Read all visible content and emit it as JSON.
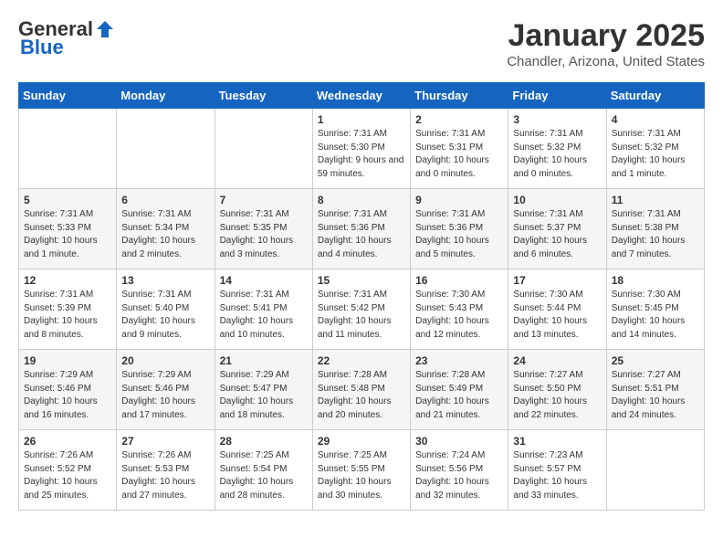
{
  "logo": {
    "general": "General",
    "blue": "Blue"
  },
  "header": {
    "title": "January 2025",
    "subtitle": "Chandler, Arizona, United States"
  },
  "days_of_week": [
    "Sunday",
    "Monday",
    "Tuesday",
    "Wednesday",
    "Thursday",
    "Friday",
    "Saturday"
  ],
  "weeks": [
    [
      {
        "num": "",
        "info": ""
      },
      {
        "num": "",
        "info": ""
      },
      {
        "num": "",
        "info": ""
      },
      {
        "num": "1",
        "info": "Sunrise: 7:31 AM\nSunset: 5:30 PM\nDaylight: 9 hours and 59 minutes."
      },
      {
        "num": "2",
        "info": "Sunrise: 7:31 AM\nSunset: 5:31 PM\nDaylight: 10 hours and 0 minutes."
      },
      {
        "num": "3",
        "info": "Sunrise: 7:31 AM\nSunset: 5:32 PM\nDaylight: 10 hours and 0 minutes."
      },
      {
        "num": "4",
        "info": "Sunrise: 7:31 AM\nSunset: 5:32 PM\nDaylight: 10 hours and 1 minute."
      }
    ],
    [
      {
        "num": "5",
        "info": "Sunrise: 7:31 AM\nSunset: 5:33 PM\nDaylight: 10 hours and 1 minute."
      },
      {
        "num": "6",
        "info": "Sunrise: 7:31 AM\nSunset: 5:34 PM\nDaylight: 10 hours and 2 minutes."
      },
      {
        "num": "7",
        "info": "Sunrise: 7:31 AM\nSunset: 5:35 PM\nDaylight: 10 hours and 3 minutes."
      },
      {
        "num": "8",
        "info": "Sunrise: 7:31 AM\nSunset: 5:36 PM\nDaylight: 10 hours and 4 minutes."
      },
      {
        "num": "9",
        "info": "Sunrise: 7:31 AM\nSunset: 5:36 PM\nDaylight: 10 hours and 5 minutes."
      },
      {
        "num": "10",
        "info": "Sunrise: 7:31 AM\nSunset: 5:37 PM\nDaylight: 10 hours and 6 minutes."
      },
      {
        "num": "11",
        "info": "Sunrise: 7:31 AM\nSunset: 5:38 PM\nDaylight: 10 hours and 7 minutes."
      }
    ],
    [
      {
        "num": "12",
        "info": "Sunrise: 7:31 AM\nSunset: 5:39 PM\nDaylight: 10 hours and 8 minutes."
      },
      {
        "num": "13",
        "info": "Sunrise: 7:31 AM\nSunset: 5:40 PM\nDaylight: 10 hours and 9 minutes."
      },
      {
        "num": "14",
        "info": "Sunrise: 7:31 AM\nSunset: 5:41 PM\nDaylight: 10 hours and 10 minutes."
      },
      {
        "num": "15",
        "info": "Sunrise: 7:31 AM\nSunset: 5:42 PM\nDaylight: 10 hours and 11 minutes."
      },
      {
        "num": "16",
        "info": "Sunrise: 7:30 AM\nSunset: 5:43 PM\nDaylight: 10 hours and 12 minutes."
      },
      {
        "num": "17",
        "info": "Sunrise: 7:30 AM\nSunset: 5:44 PM\nDaylight: 10 hours and 13 minutes."
      },
      {
        "num": "18",
        "info": "Sunrise: 7:30 AM\nSunset: 5:45 PM\nDaylight: 10 hours and 14 minutes."
      }
    ],
    [
      {
        "num": "19",
        "info": "Sunrise: 7:29 AM\nSunset: 5:46 PM\nDaylight: 10 hours and 16 minutes."
      },
      {
        "num": "20",
        "info": "Sunrise: 7:29 AM\nSunset: 5:46 PM\nDaylight: 10 hours and 17 minutes."
      },
      {
        "num": "21",
        "info": "Sunrise: 7:29 AM\nSunset: 5:47 PM\nDaylight: 10 hours and 18 minutes."
      },
      {
        "num": "22",
        "info": "Sunrise: 7:28 AM\nSunset: 5:48 PM\nDaylight: 10 hours and 20 minutes."
      },
      {
        "num": "23",
        "info": "Sunrise: 7:28 AM\nSunset: 5:49 PM\nDaylight: 10 hours and 21 minutes."
      },
      {
        "num": "24",
        "info": "Sunrise: 7:27 AM\nSunset: 5:50 PM\nDaylight: 10 hours and 22 minutes."
      },
      {
        "num": "25",
        "info": "Sunrise: 7:27 AM\nSunset: 5:51 PM\nDaylight: 10 hours and 24 minutes."
      }
    ],
    [
      {
        "num": "26",
        "info": "Sunrise: 7:26 AM\nSunset: 5:52 PM\nDaylight: 10 hours and 25 minutes."
      },
      {
        "num": "27",
        "info": "Sunrise: 7:26 AM\nSunset: 5:53 PM\nDaylight: 10 hours and 27 minutes."
      },
      {
        "num": "28",
        "info": "Sunrise: 7:25 AM\nSunset: 5:54 PM\nDaylight: 10 hours and 28 minutes."
      },
      {
        "num": "29",
        "info": "Sunrise: 7:25 AM\nSunset: 5:55 PM\nDaylight: 10 hours and 30 minutes."
      },
      {
        "num": "30",
        "info": "Sunrise: 7:24 AM\nSunset: 5:56 PM\nDaylight: 10 hours and 32 minutes."
      },
      {
        "num": "31",
        "info": "Sunrise: 7:23 AM\nSunset: 5:57 PM\nDaylight: 10 hours and 33 minutes."
      },
      {
        "num": "",
        "info": ""
      }
    ]
  ]
}
